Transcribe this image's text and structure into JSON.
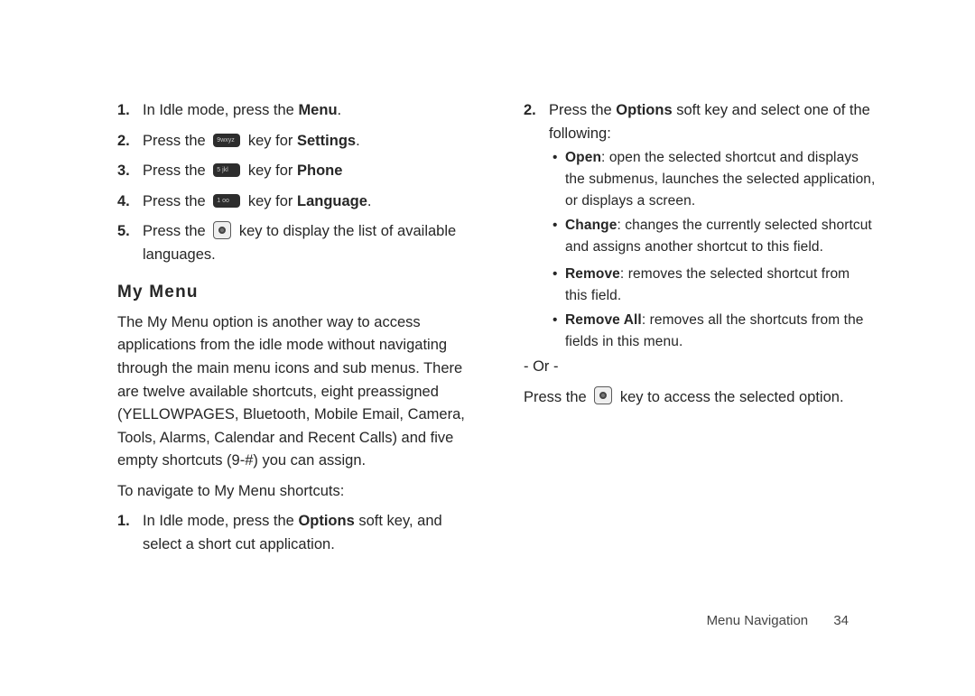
{
  "steps1": [
    {
      "num": "1.",
      "pre": "In Idle mode, press the ",
      "bold": "Menu",
      "post": "."
    },
    {
      "num": "2.",
      "pre": "Press the ",
      "keyLabel": "9wxyz",
      "mid": " key for ",
      "bold": "Settings",
      "post": "."
    },
    {
      "num": "3.",
      "pre": "Press the ",
      "keyLabel": "5 jkl",
      "mid": " key for ",
      "bold": "Phone",
      "post": ""
    },
    {
      "num": "4.",
      "pre": "Press the ",
      "keyLabel": "1 oo",
      "mid": " key for ",
      "bold": "Language",
      "post": "."
    },
    {
      "num": "5.",
      "pre": "Press the ",
      "okKey": true,
      "mid": " key to display the list of available languages."
    }
  ],
  "sectionTitle": "My Menu",
  "myMenuIntro": "The My Menu option is another way to access applications from the idle mode without navigating through the main menu icons and sub menus. There are twelve available shortcuts, eight preassigned (YELLOWPAGES, Bluetooth, Mobile Email, Camera, Tools, Alarms, Calendar and Recent Calls) and five empty shortcuts (9-#) you can assign.",
  "navigateLine": "To navigate to My Menu shortcuts:",
  "steps2": [
    {
      "num": "1.",
      "pre": "In Idle mode, press the ",
      "bold": "Options",
      "post": " soft key, and select a short cut application."
    },
    {
      "num": "2.",
      "pre": "Press the ",
      "bold": "Options",
      "post": " soft key and select one of the following:"
    }
  ],
  "optionsBullets1": [
    {
      "term": "Open",
      "desc": ": open the selected shortcut and displays the submenus, launches the selected application, or displays a screen."
    },
    {
      "term": "Change",
      "desc": ": changes the currently selected shortcut and assigns another shortcut to this field."
    }
  ],
  "optionsBullets2": [
    {
      "term": "Remove",
      "desc": ": removes the selected shortcut from this field."
    },
    {
      "term": "Remove All",
      "desc": ": removes all the shortcuts from the fields in this menu."
    }
  ],
  "orText": "- Or -",
  "pressOkLine_pre": "Press the ",
  "pressOkLine_post": " key to access the selected option.",
  "footerSection": "Menu Navigation",
  "footerPage": "34"
}
